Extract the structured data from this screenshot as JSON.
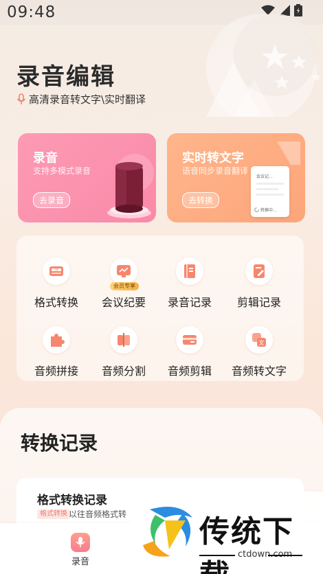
{
  "status_bar": {
    "time": "09:48"
  },
  "header": {
    "title": "录音编辑",
    "subtitle": "高清录音转文字\\实时翻译"
  },
  "cards": {
    "record": {
      "title": "录音",
      "desc": "支持多模式录音",
      "button": "去录音"
    },
    "convert": {
      "title": "实时转文字",
      "desc": "语音同步录音翻译",
      "button": "去转换",
      "doc_title": "会议记...",
      "doc_status": "转换中..."
    }
  },
  "tools": [
    {
      "label": "格式转换",
      "icon": "format-icon"
    },
    {
      "label": "会议纪要",
      "icon": "meeting-icon",
      "badge": "会员专享"
    },
    {
      "label": "录音记录",
      "icon": "record-book-icon"
    },
    {
      "label": "剪辑记录",
      "icon": "edit-note-icon"
    },
    {
      "label": "音频拼接",
      "icon": "puzzle-icon"
    },
    {
      "label": "音频分割",
      "icon": "split-icon"
    },
    {
      "label": "音频剪辑",
      "icon": "audio-cut-icon"
    },
    {
      "label": "音频转文字",
      "icon": "translate-icon"
    }
  ],
  "records": {
    "title": "转换记录",
    "item": {
      "name": "格式转换记录",
      "tag": "格式转换",
      "desc": "以往音频格式转"
    }
  },
  "bottom_nav": {
    "record_label": "录音"
  },
  "watermark": {
    "text": "传统下载",
    "url": "ctdown.com"
  },
  "colors": {
    "pink": "#fa8fac",
    "orange": "#fdaa7f",
    "accent": "#f07a6a"
  }
}
